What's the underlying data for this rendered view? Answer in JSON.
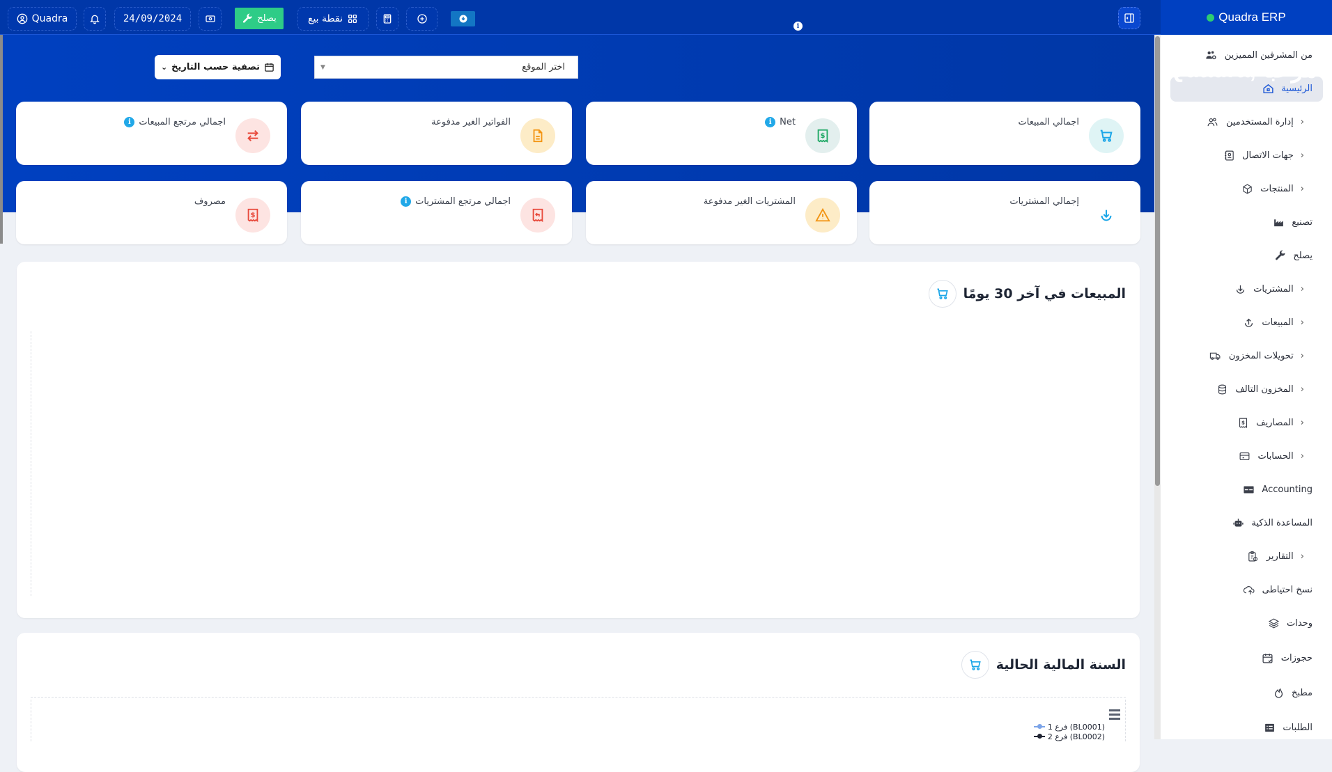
{
  "topbar": {
    "user_label": "Quadra",
    "date": "24/09/2024",
    "repair_label": "يصلح",
    "pos_label": "نقطة بيع"
  },
  "sidebar": {
    "brand": "Quadra ERP",
    "items": [
      {
        "label": "من المشرفين المميزين",
        "icon": "users-cog-icon",
        "chevron": false
      },
      {
        "label": "الرئيسية",
        "icon": "home-icon",
        "chevron": false,
        "active": true
      },
      {
        "label": "إدارة المستخدمين",
        "icon": "users-icon",
        "chevron": true
      },
      {
        "label": "جهات الاتصال",
        "icon": "contact-book-icon",
        "chevron": true
      },
      {
        "label": "المنتجات",
        "icon": "box-icon",
        "chevron": true
      },
      {
        "label": "تصنيع",
        "icon": "factory-icon",
        "chevron": false
      },
      {
        "label": "يصلح",
        "icon": "wrench-icon",
        "chevron": false
      },
      {
        "label": "المشتريات",
        "icon": "download-circle-icon",
        "chevron": true
      },
      {
        "label": "المبيعات",
        "icon": "upload-circle-icon",
        "chevron": true
      },
      {
        "label": "تحويلات المخزون",
        "icon": "truck-icon",
        "chevron": true
      },
      {
        "label": "المخزون التالف",
        "icon": "database-icon",
        "chevron": true
      },
      {
        "label": "المصاريف",
        "icon": "receipt-dollar-icon",
        "chevron": true
      },
      {
        "label": "الحسابات",
        "icon": "credit-card-icon",
        "chevron": true
      },
      {
        "label": "Accounting",
        "icon": "card-icon",
        "chevron": false
      },
      {
        "label": "المساعدة الذكية",
        "icon": "robot-icon",
        "chevron": false
      },
      {
        "label": "التقارير",
        "icon": "clipboard-clock-icon",
        "chevron": true
      },
      {
        "label": "نسخ احتياطى",
        "icon": "cloud-upload-icon",
        "chevron": false
      },
      {
        "label": "وحدات",
        "icon": "layers-icon",
        "chevron": false
      },
      {
        "label": "حجوزات",
        "icon": "calendar-check-icon",
        "chevron": false
      },
      {
        "label": "مطبخ",
        "icon": "flame-icon",
        "chevron": false
      },
      {
        "label": "الطلبات",
        "icon": "list-icon",
        "chevron": false
      }
    ]
  },
  "hero": {
    "title": "Quadra, مرحبا",
    "filter_label": "تصفية حسب التاريخ",
    "site_placeholder": "اختر الموقع"
  },
  "cards": [
    {
      "label": "اجمالي المبيعات",
      "icon": "cart-icon",
      "info": false
    },
    {
      "label": "Net",
      "icon": "receipt-dollar-icon",
      "info": true
    },
    {
      "label": "الفواتير الغير مدفوعة",
      "icon": "document-icon",
      "info": false
    },
    {
      "label": "اجمالي مرتجع المبيعات",
      "icon": "swap-arrows-icon",
      "info": true
    },
    {
      "label": "إجمالي المشتريات",
      "icon": "download-circle-icon",
      "info": false
    },
    {
      "label": "المشتريات الغير مدفوعة",
      "icon": "warning-icon",
      "info": false
    },
    {
      "label": "اجمالي مرتجع المشتريات",
      "icon": "receipt-return-icon",
      "info": true
    },
    {
      "label": "مصروف",
      "icon": "receipt-dollar-icon",
      "info": false
    }
  ],
  "colors": {
    "primary": "#0040c1",
    "green": "#2ecc87",
    "info": "#21a8e8"
  },
  "panels": {
    "sales_30_days": {
      "title": "المبيعات في آخر 30 يومًا"
    },
    "fiscal_year": {
      "title": "السنة المالية الحالية",
      "legend": [
        {
          "label": "فرع 1 (BL0001)",
          "color": "#7ca4e8"
        },
        {
          "label": "فرع 2 (BL0002)",
          "color": "#202533"
        }
      ]
    }
  }
}
